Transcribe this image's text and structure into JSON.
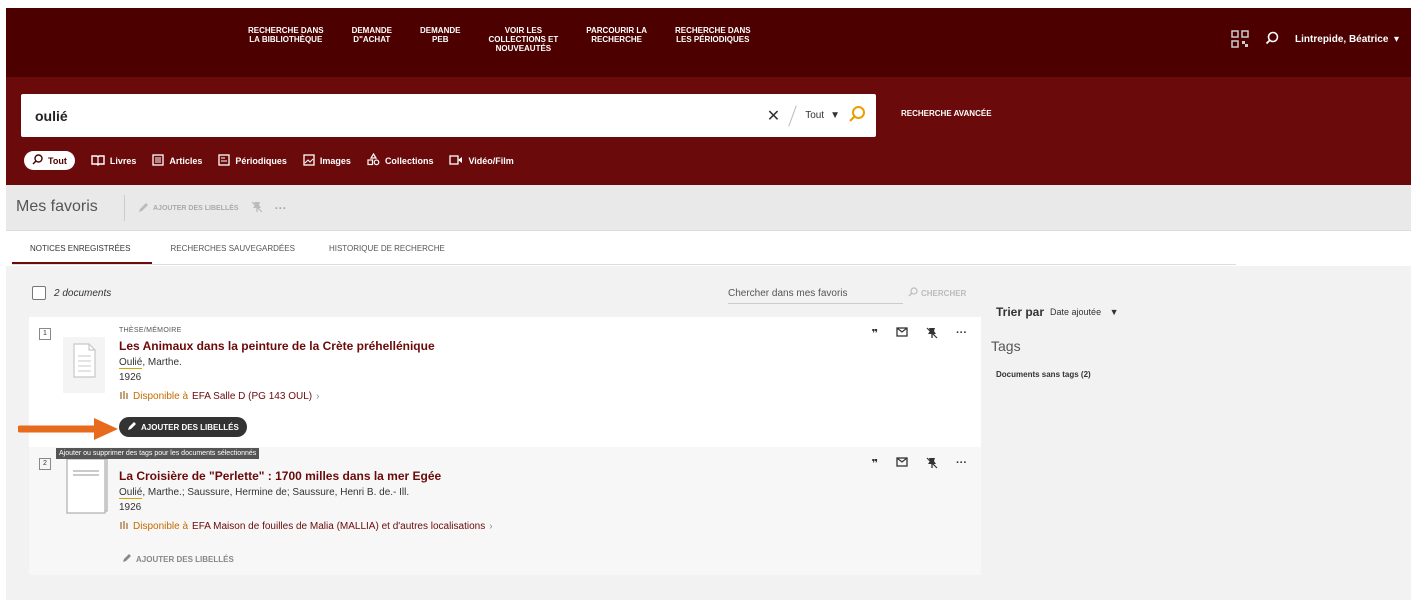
{
  "colors": {
    "brand_dark": "#4c0000",
    "brand": "#6b0a0a",
    "accent_orange": "#e86a1c",
    "availability": "#c46b00"
  },
  "topnav": [
    {
      "label": "RECHERCHE DANS\nLA BIBLIOTHÈQUE"
    },
    {
      "label": "DEMANDE\nD\"ACHAT"
    },
    {
      "label": "DEMANDE\nPEB"
    },
    {
      "label": "VOIR LES\nCOLLECTIONS ET\nNOUVEAUTÉS"
    },
    {
      "label": "PARCOURIR LA\nRECHERCHE"
    },
    {
      "label": "RECHERCHE DANS\nLES PÉRIODIQUES"
    }
  ],
  "user": {
    "name": "Lintrepide, Béatrice"
  },
  "search": {
    "query": "oulié",
    "scope": "Tout",
    "advanced_label": "RECHERCHE AVANCÉE"
  },
  "type_tabs": [
    {
      "label": "Tout",
      "icon": "search-icon"
    },
    {
      "label": "Livres",
      "icon": "book-icon"
    },
    {
      "label": "Articles",
      "icon": "article-icon"
    },
    {
      "label": "Périodiques",
      "icon": "journal-icon"
    },
    {
      "label": "Images",
      "icon": "image-icon"
    },
    {
      "label": "Collections",
      "icon": "collections-icon"
    },
    {
      "label": "Vidéo/Film",
      "icon": "video-icon"
    }
  ],
  "favorites": {
    "title": "Mes favoris",
    "add_tags_label": "AJOUTER DES LIBELLÉS",
    "more": "···",
    "tabs": [
      "NOTICES ENREGISTRÉES",
      "RECHERCHES SAUVEGARDÉES",
      "HISTORIQUE DE RECHERCHE"
    ],
    "count": "2 documents",
    "search_placeholder": "Chercher dans mes favoris",
    "search_button": "CHERCHER"
  },
  "records": [
    {
      "num": "1",
      "type": "THÈSE/MÉMOIRE",
      "title": "Les Animaux dans la peinture de la Crète préhellénique",
      "author_hl": "Oulié",
      "author_rest": ", Marthe.",
      "year": "1926",
      "avail_prefix": "Disponible à",
      "avail_loc": "EFA  Salle D (PG 143 OUL)",
      "tag_button": "AJOUTER DES LIBELLÉS"
    },
    {
      "num": "2",
      "type": "",
      "title": "La Croisière de \"Perlette\" : 1700 milles dans la mer Egée",
      "author_hl": "Oulié",
      "author_rest": ", Marthe.; Saussure, Hermine de; Saussure, Henri B. de.- Ill.",
      "year": "1926",
      "avail_prefix": "Disponible à",
      "avail_loc": "EFA  Maison de fouilles de Malia (MALLIA) et d'autres localisations",
      "tag_button": "AJOUTER DES LIBELLÉS"
    }
  ],
  "tooltip": "Ajouter ou supprimer des tags pour les documents sélectionnés",
  "sidebar": {
    "sort_label": "Trier par",
    "sort_value": "Date ajoutée",
    "tags_title": "Tags",
    "untagged": "Documents sans tags (2)"
  }
}
